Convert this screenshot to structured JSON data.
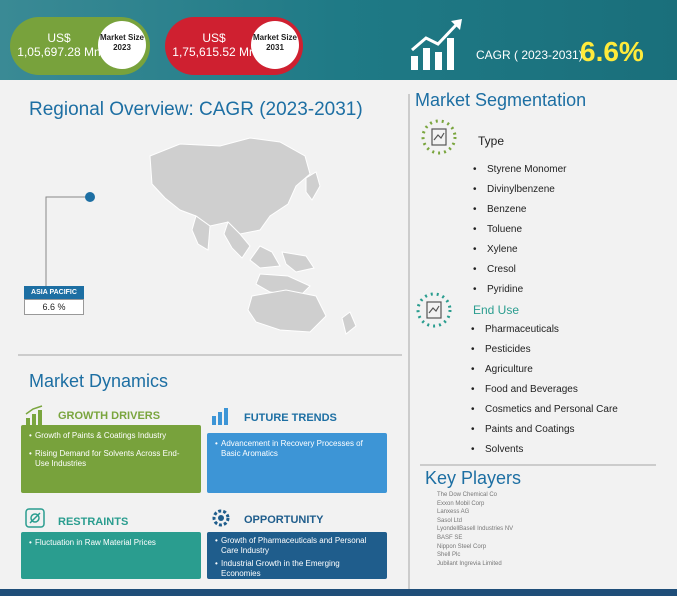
{
  "header": {
    "market_2023": {
      "value": "US$ 1,05,697.28 Mn",
      "label": "Market Size 2023"
    },
    "market_2031": {
      "value": "US$ 1,75,615.52 Mn",
      "label": "Market Size 2031"
    },
    "cagr_label": "CAGR ( 2023-2031)",
    "cagr_value": "6.6%"
  },
  "regional": {
    "title": "Regional Overview: CAGR (2023-2031)",
    "region": "ASIA PACIFIC",
    "region_value": "6.6 %"
  },
  "dynamics": {
    "title": "Market Dynamics",
    "growth_drivers": {
      "title": "GROWTH DRIVERS",
      "items": [
        "Growth of Paints & Coatings Industry",
        "Rising Demand for Solvents Across End-Use Industries"
      ]
    },
    "future_trends": {
      "title": "FUTURE TRENDS",
      "items": [
        "Advancement in Recovery Processes of Basic Aromatics"
      ]
    },
    "restraints": {
      "title": "RESTRAINTS",
      "items": [
        "Fluctuation in Raw Material Prices"
      ]
    },
    "opportunity": {
      "title": "OPPORTUNITY",
      "items": [
        "Growth of Pharmaceuticals and Personal Care Industry",
        "Industrial Growth in the Emerging Economies"
      ]
    }
  },
  "segmentation": {
    "title": "Market Segmentation",
    "type": {
      "label": "Type",
      "items": [
        "Styrene Monomer",
        "Divinylbenzene",
        "Benzene",
        "Toluene",
        "Xylene",
        "Cresol",
        "Pyridine"
      ]
    },
    "end_use": {
      "label": "End Use",
      "items": [
        "Pharmaceuticals",
        "Pesticides",
        "Agriculture",
        "Food and Beverages",
        "Cosmetics and Personal Care",
        "Paints and Coatings",
        "Solvents"
      ]
    }
  },
  "key_players": {
    "title": "Key Players",
    "items": [
      "The Dow Chemical Co",
      "Exxon Mobil Corp",
      "Lanxess AG",
      "Sasol Ltd",
      "LyondellBasell Industries NV",
      "BASF SE",
      "Nippon Steel Corp",
      "Shell Plc",
      "Jubilant Ingrevia Limited"
    ]
  },
  "colors": {
    "header_teal": "#1f7a86",
    "green": "#78a23c",
    "red": "#cf2030",
    "yellow": "#ffeb3b",
    "blue": "#1d6fa3",
    "teal_box": "#2a9d8f",
    "light_blue_box": "#3d95d6",
    "navy_box": "#1f5d8c"
  }
}
